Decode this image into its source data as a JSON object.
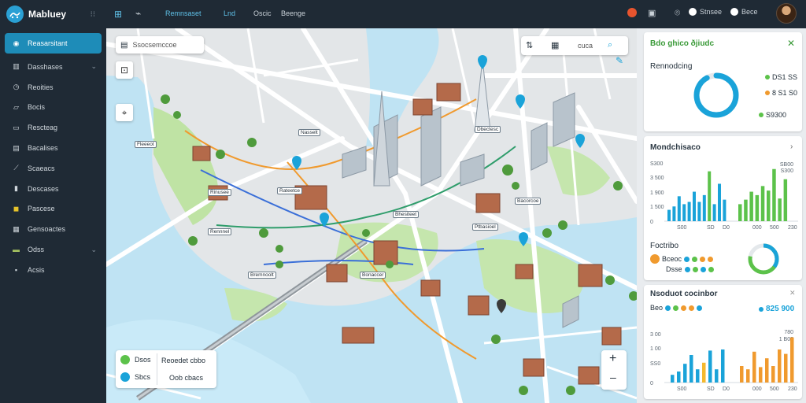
{
  "app": {
    "name": "Mabluey",
    "colors": {
      "sidebar_bg": "#1f2a35",
      "accent": "#1e8cb8",
      "blue": "#1aa3d9",
      "green": "#5cc24a",
      "orange": "#f09a2e"
    }
  },
  "sidebar": {
    "items": [
      {
        "label": "Reasarsitant",
        "icon": "search-icon",
        "active": true,
        "chevron": false
      },
      {
        "label": "Dasshases",
        "icon": "dashboard-icon",
        "active": false,
        "chevron": true
      },
      {
        "label": "Reoities",
        "icon": "clock-icon",
        "active": false,
        "chevron": false
      },
      {
        "label": "Bocis",
        "icon": "map-icon",
        "active": false,
        "chevron": false
      },
      {
        "label": "Rescteag",
        "icon": "folder-icon",
        "active": false,
        "chevron": false
      },
      {
        "label": "Bacalises",
        "icon": "list-icon",
        "active": false,
        "chevron": false
      },
      {
        "label": "Scaeacs",
        "icon": "chart-icon",
        "active": false,
        "chevron": false
      },
      {
        "label": "Descases",
        "icon": "bookmark-icon",
        "active": false,
        "chevron": false
      },
      {
        "label": "Pascese",
        "icon": "badge-icon",
        "active": false,
        "chevron": false
      },
      {
        "label": "Gensoactes",
        "icon": "table-icon",
        "active": false,
        "chevron": false
      },
      {
        "label": "Odss",
        "icon": "tag-icon",
        "active": false,
        "chevron": true
      },
      {
        "label": "Acsis",
        "icon": "book-icon",
        "active": false,
        "chevron": false
      }
    ]
  },
  "topbar": {
    "links": [
      "Remnsaset",
      "Lnd"
    ],
    "texts": [
      "Oscic",
      "Beenge"
    ],
    "right": [
      "Stnsee",
      "Bece"
    ]
  },
  "map": {
    "search_placeholder": "Ssocsemccoe",
    "toolbar_search": "cuca",
    "labels": [
      "Nasselt",
      "Fleeeot",
      "Rinusee",
      "Rateetce",
      "Bhesiteet",
      "Rennnel",
      "Bremnoolt",
      "Bonaccer",
      "Ptbasioel",
      "Bacorcoe",
      "Dbectesc"
    ],
    "legend": [
      {
        "key": "Dsos",
        "value": "Reoedet cbbo"
      },
      {
        "key": "Sbcs",
        "value": "Oob cbacs"
      }
    ],
    "zoom_in": "+",
    "zoom_out": "–"
  },
  "panel1": {
    "title": "Bdo ghico ðjiudc",
    "subtitle": "Rennodcing",
    "values": [
      "DS1 SS",
      "8  S1 S0",
      "S9300"
    ],
    "donut_fraction": 0.92
  },
  "panel2": {
    "title": "Mondchisaco",
    "yticks_left": [
      "S300",
      "3 500",
      "1 900",
      "1 500",
      "0"
    ],
    "yticks_right": [
      "SB00",
      "S300"
    ],
    "xticks_left": [
      "S00",
      "SD",
      "D0"
    ],
    "xticks_right": [
      "000",
      "500",
      "230"
    ],
    "bars_left": [
      20,
      26,
      44,
      30,
      34,
      52,
      34,
      46,
      88,
      30,
      66,
      38
    ],
    "bars_right": [
      30,
      38,
      52,
      46,
      62,
      54,
      92,
      40,
      74
    ],
    "footer_title": "Foctribo",
    "footer_rows": [
      "Bceoc",
      "Dsse"
    ],
    "donut_fraction": 0.78
  },
  "panel3": {
    "title": "Nsoduot cocinbor",
    "legend_label": "Beo",
    "value": "825 900",
    "yticks_left": [
      "3 00",
      "1 00",
      "SS0",
      "0"
    ],
    "yticks_right": [
      "780",
      "1 B00"
    ],
    "xticks_left": [
      "S00",
      "SD",
      "D0"
    ],
    "xticks_right": [
      "000",
      "500",
      "230"
    ],
    "bars_blue": [
      14,
      20,
      34,
      50,
      24,
      36,
      58,
      24,
      60
    ],
    "bars_orange": [
      30,
      24,
      56,
      28,
      44,
      30,
      60,
      52,
      82
    ]
  }
}
